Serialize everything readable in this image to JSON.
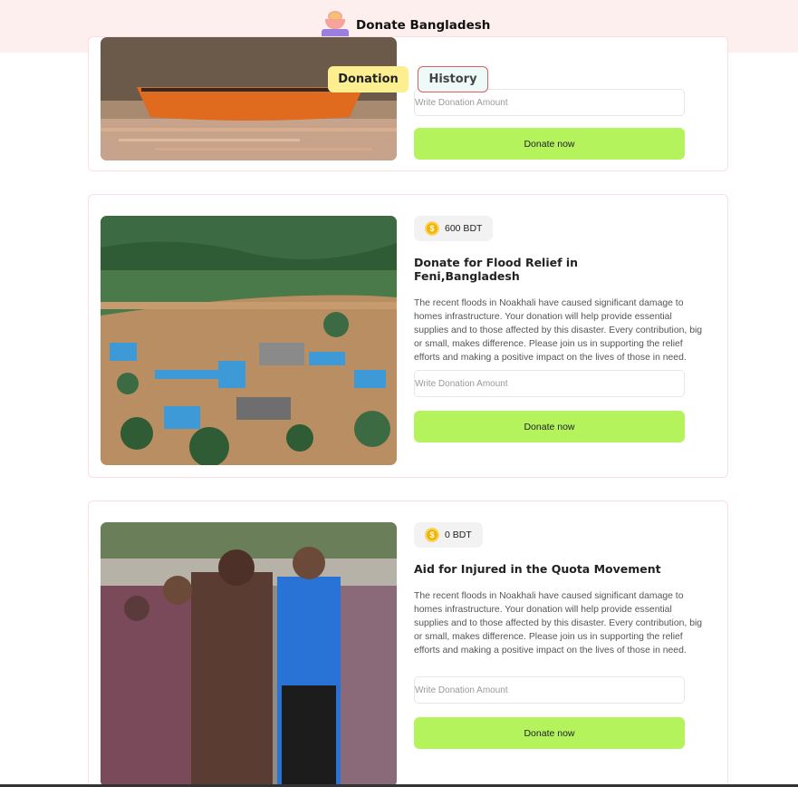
{
  "app": {
    "title": "Donate Bangladesh"
  },
  "tabs": [
    {
      "label": "Donation"
    },
    {
      "label": "History"
    }
  ],
  "cards": [
    {
      "input_placeholder": "Write Donation Amount",
      "button_label": "Donate now"
    },
    {
      "amount": "600 BDT",
      "title": "Donate for Flood Relief in Feni,Bangladesh",
      "description": "The recent floods in Noakhali have caused significant damage to homes infrastructure. Your donation will help provide essential supplies and to those affected by this disaster. Every contribution, big or small, makes difference. Please join us in supporting the relief efforts and making a positive impact on the lives of those in need.",
      "input_placeholder": "Write Donation Amount",
      "button_label": "Donate now"
    },
    {
      "amount": "0 BDT",
      "title": "Aid for Injured in the Quota Movement",
      "description": "The recent floods in Noakhali have caused significant damage to homes infrastructure. Your donation will help provide essential supplies and to those affected by this disaster. Every contribution, big or small, makes difference. Please join us in supporting the relief efforts and making a positive impact on the lives of those in need.",
      "input_placeholder": "Write Donation Amount",
      "button_label": "Donate now"
    }
  ],
  "colors": {
    "header_bg": "#fdefed",
    "tab_active_bg": "#fdee90",
    "tab_inactive_border": "#e05b61",
    "donate_button": "#b5f35d",
    "card_border": "#fbdde2"
  },
  "icons": {
    "logo": "donation-box-icon",
    "badge": "coin-icon"
  }
}
